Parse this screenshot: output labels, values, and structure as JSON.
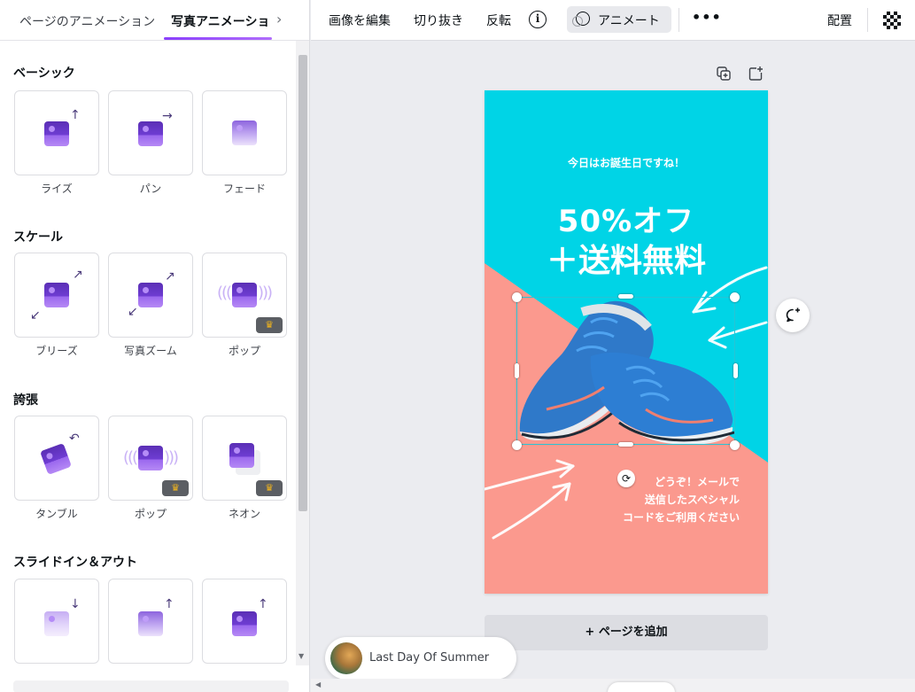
{
  "panel": {
    "tabs": [
      {
        "label": "ページのアニメーション"
      },
      {
        "label": "写真アニメーション"
      }
    ],
    "next_icon": "chevron-right-icon",
    "sections": [
      {
        "title": "ベーシック",
        "items": [
          {
            "label": "ライズ"
          },
          {
            "label": "パン"
          },
          {
            "label": "フェード"
          }
        ]
      },
      {
        "title": "スケール",
        "items": [
          {
            "label": "ブリーズ"
          },
          {
            "label": "写真ズーム"
          },
          {
            "label": "ポップ",
            "premium": true
          }
        ]
      },
      {
        "title": "誇張",
        "items": [
          {
            "label": "タンブル"
          },
          {
            "label": "ポップ",
            "premium": true
          },
          {
            "label": "ネオン",
            "premium": true
          }
        ]
      },
      {
        "title": "スライドイン＆アウト",
        "items": [
          {
            "label": ""
          },
          {
            "label": ""
          },
          {
            "label": ""
          }
        ]
      }
    ]
  },
  "toolbar": {
    "edit_image": "画像を編集",
    "crop": "切り抜き",
    "flip": "反転",
    "info": "i",
    "animate": "アニメート",
    "more": "•••",
    "position": "配置"
  },
  "design": {
    "line_small": "今日はお誕生日ですね！",
    "line_big1": "50%オフ",
    "line_big2": "＋送料無料",
    "body_lines": [
      "どうぞ！メールで",
      "送信したスペシャル",
      "コードをご利用ください"
    ],
    "colors": {
      "cyan": "#00d4e6",
      "salmon": "#fb998e",
      "accent": "#8a3ffc"
    }
  },
  "canvas": {
    "add_page": "+ ページを追加",
    "music_title": "Last Day Of Summer"
  }
}
